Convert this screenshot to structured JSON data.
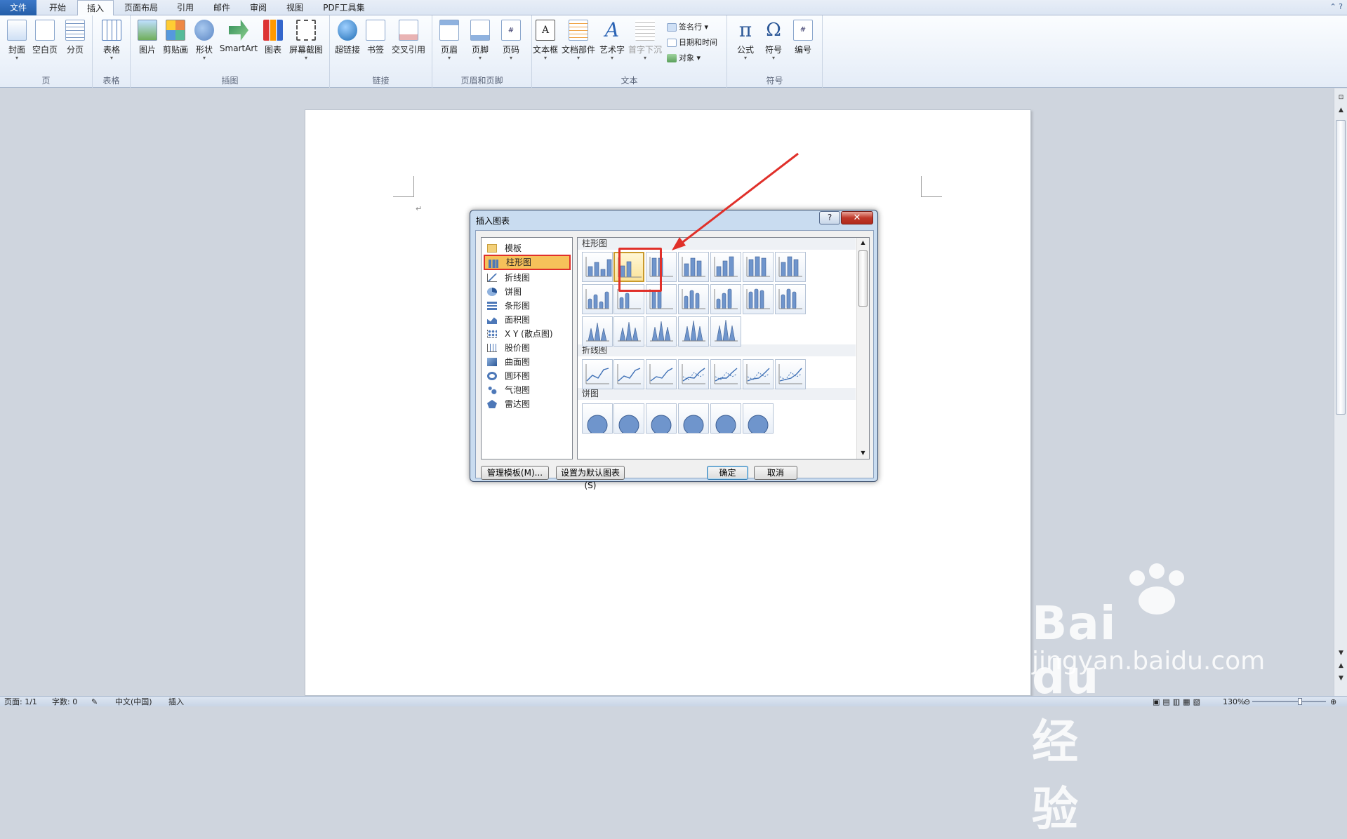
{
  "tabs": [
    {
      "label": "文件",
      "type": "file"
    },
    {
      "label": "开始"
    },
    {
      "label": "插入",
      "active": true
    },
    {
      "label": "页面布局"
    },
    {
      "label": "引用"
    },
    {
      "label": "邮件"
    },
    {
      "label": "审阅"
    },
    {
      "label": "视图"
    },
    {
      "label": "PDF工具集"
    }
  ],
  "ribbon": {
    "groups": [
      {
        "label": "页",
        "buttons": [
          "封面",
          "空白页",
          "分页"
        ]
      },
      {
        "label": "表格",
        "buttons": [
          "表格"
        ]
      },
      {
        "label": "插图",
        "buttons": [
          "图片",
          "剪贴画",
          "形状",
          "SmartArt",
          "图表",
          "屏幕截图"
        ]
      },
      {
        "label": "链接",
        "buttons": [
          "超链接",
          "书签",
          "交叉引用"
        ]
      },
      {
        "label": "页眉和页脚",
        "buttons": [
          "页眉",
          "页脚",
          "页码"
        ]
      },
      {
        "label": "文本",
        "buttons": [
          "文本框",
          "文档部件",
          "艺术字",
          "首字下沉"
        ],
        "small": [
          "签名行",
          "日期和时间",
          "对象"
        ]
      },
      {
        "label": "符号",
        "buttons": [
          "公式",
          "符号",
          "编号"
        ]
      }
    ]
  },
  "dialog": {
    "title": "插入图表",
    "help_label": "?",
    "close_label": "✕",
    "categories": [
      "模板",
      "柱形图",
      "折线图",
      "饼图",
      "条形图",
      "面积图",
      "X Y (散点图)",
      "股价图",
      "曲面图",
      "圆环图",
      "气泡图",
      "雷达图"
    ],
    "selected_category": "柱形图",
    "sections": [
      "柱形图",
      "折线图",
      "饼图"
    ],
    "buttons": {
      "manage": "管理模板(M)...",
      "set_default": "设置为默认图表(S)",
      "ok": "确定",
      "cancel": "取消"
    }
  },
  "status": {
    "page": "页面: 1/1",
    "words": "字数: 0",
    "lang": "中文(中国)",
    "mode": "插入",
    "zoom": "130%"
  },
  "watermark": {
    "logo": "Bai du 经验",
    "url": "jingyan.baidu.com"
  },
  "colors": {
    "highlight": "#e0302a",
    "selection": "#f6c15a",
    "accent": "#2b5797"
  }
}
